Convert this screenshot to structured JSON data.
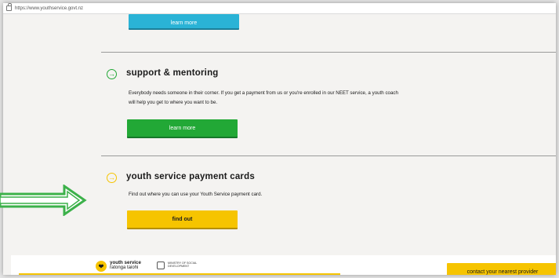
{
  "browser": {
    "url": "https://www.youthservice.govt.nz"
  },
  "sections": {
    "top": {
      "button_label": "learn more"
    },
    "support": {
      "heading": "support & mentoring",
      "body_line1": "Everybody needs someone in their corner. If you get a payment from us or you're enrolled in our NEET service, a youth coach",
      "body_line2": "will help you get to where you want to be.",
      "button_label": "learn more"
    },
    "payment_cards": {
      "heading": "youth service payment cards",
      "body": "Find out where you can use your Youth Service payment card.",
      "button_label": "find out"
    }
  },
  "footer": {
    "brand_line1": "youth service",
    "brand_line2": "ratonga taiohi",
    "ministry_line1": "MINISTRY OF SOCIAL",
    "ministry_line2": "DEVELOPMENT",
    "contact_button": "contact your nearest provider"
  },
  "colors": {
    "green": "#22a836",
    "yellow": "#f6c400",
    "blue": "#2ab3d6",
    "arrow": "#3cb14a"
  },
  "icons": {
    "section_icon": "circle-arrow-right-icon",
    "annotation": "big-arrow-right-icon"
  }
}
